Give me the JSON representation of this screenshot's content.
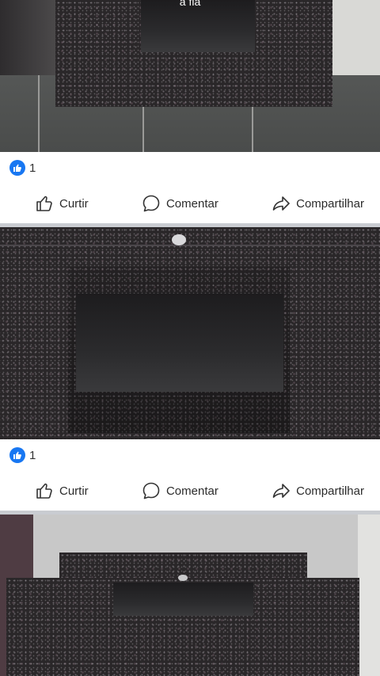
{
  "posts": [
    {
      "photo_caption": "a fia",
      "reactions": {
        "like_count": "1"
      },
      "actions": {
        "like": "Curtir",
        "comment": "Comentar",
        "share": "Compartilhar"
      }
    },
    {
      "reactions": {
        "like_count": "1"
      },
      "actions": {
        "like": "Curtir",
        "comment": "Comentar",
        "share": "Compartilhar"
      }
    },
    {}
  ],
  "colors": {
    "like_badge": "#1877f2",
    "divider": "#c9ccd1"
  },
  "icons": [
    "like-badge-icon",
    "thumbs-up-icon",
    "comment-bubble-icon",
    "share-arrow-icon"
  ]
}
